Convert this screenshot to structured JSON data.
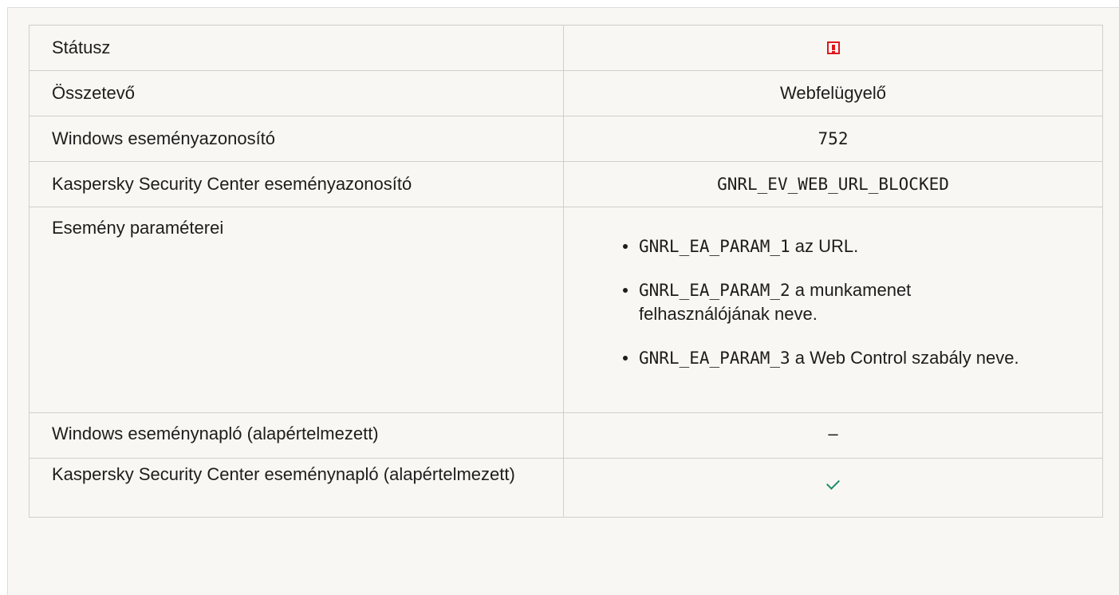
{
  "rows": {
    "status": {
      "label": "Státusz",
      "icon": "warning-icon",
      "icon_color": "#e0161b"
    },
    "component": {
      "label": "Összetevő",
      "value": "Webfelügyelő"
    },
    "windows_event_id": {
      "label": "Windows eseményazonosító",
      "value": "752"
    },
    "ksc_event_id": {
      "label": "Kaspersky Security Center eseményazonosító",
      "value": "GNRL_EV_WEB_URL_BLOCKED"
    },
    "event_params": {
      "label": "Esemény paraméterei",
      "items": [
        {
          "code": "GNRL_EA_PARAM_1",
          "text": " az URL."
        },
        {
          "code": "GNRL_EA_PARAM_2",
          "text": " a munkamenet felhasználójának neve."
        },
        {
          "code": "GNRL_EA_PARAM_3",
          "text": " a Web Control szabály neve."
        }
      ]
    },
    "windows_event_log": {
      "label": "Windows eseménynapló (alapértelmezett)",
      "value": "–"
    },
    "ksc_event_log": {
      "label": "Kaspersky Security Center eseménynapló (alapértelmezett)",
      "icon": "checkmark-icon",
      "icon_color": "#1e8a6a"
    }
  }
}
